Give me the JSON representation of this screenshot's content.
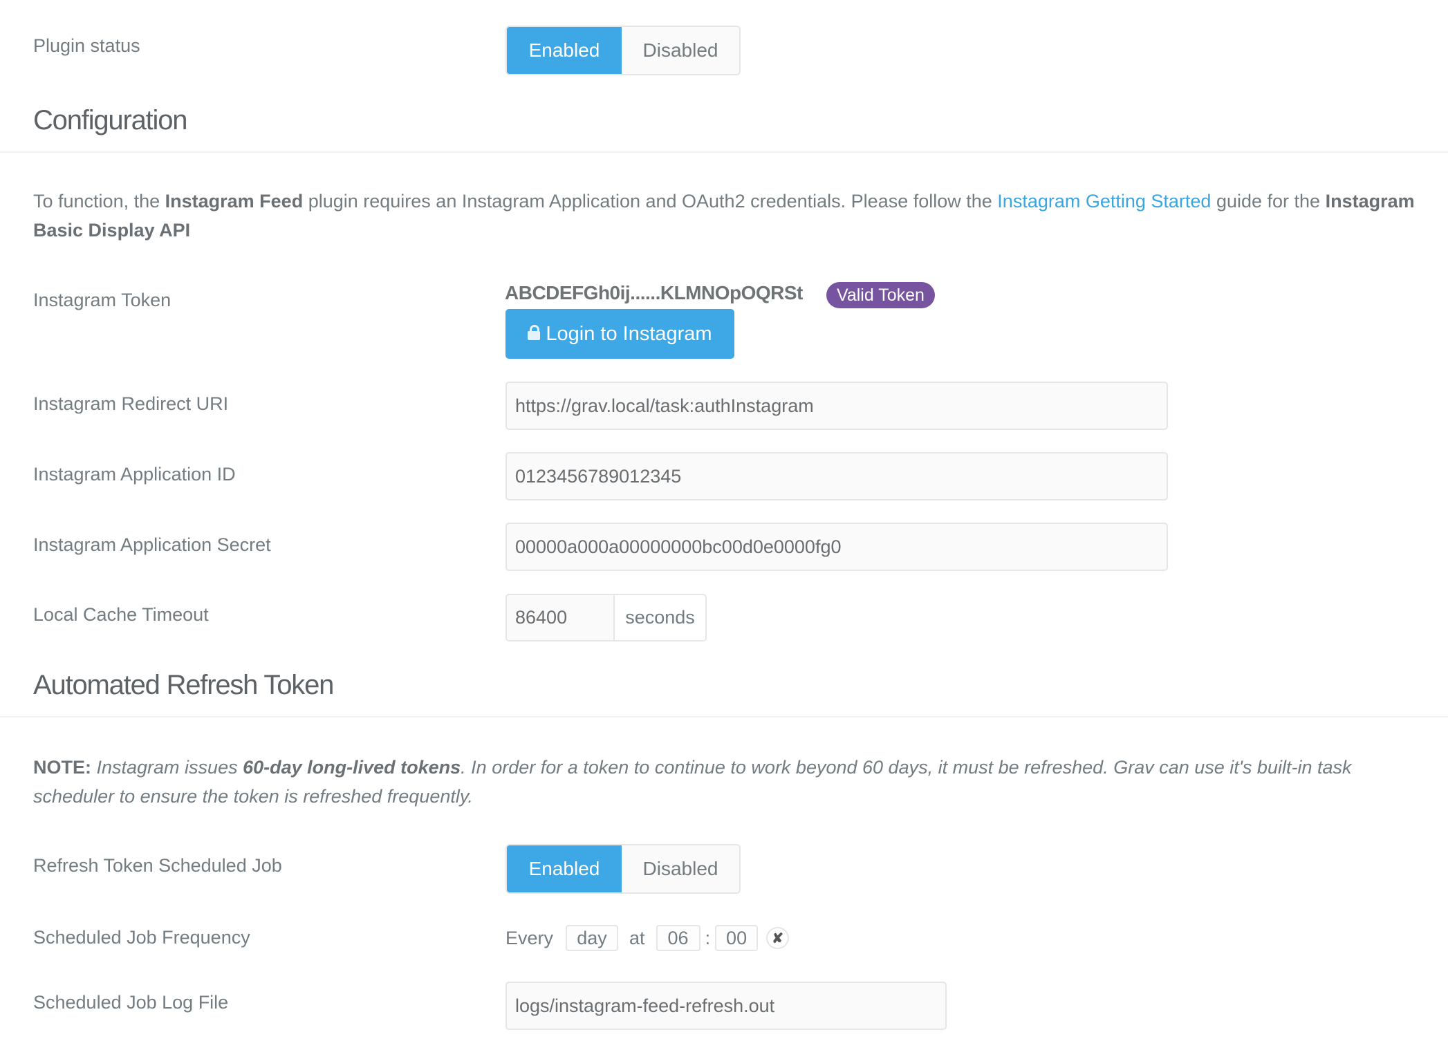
{
  "plugin_status": {
    "label": "Plugin status",
    "options": [
      "Enabled",
      "Disabled"
    ],
    "selected": "Enabled"
  },
  "configuration": {
    "heading": "Configuration",
    "intro": {
      "t1": "To function, the ",
      "b1": "Instagram Feed",
      "t2": " plugin requires an Instagram Application and OAuth2 credentials. Please follow the ",
      "link": "Instagram Getting Started",
      "t3": " guide for the ",
      "b2": "Instagram Basic Display API"
    },
    "token": {
      "label": "Instagram Token",
      "value": "ABCDEFGh0ij......KLMNOpOQRSt",
      "badge": "Valid Token",
      "login_button": "Login to Instagram"
    },
    "redirect_uri": {
      "label": "Instagram Redirect URI",
      "value": "https://grav.local/task:authInstagram"
    },
    "app_id": {
      "label": "Instagram Application ID",
      "value": "0123456789012345"
    },
    "app_secret": {
      "label": "Instagram Application Secret",
      "value": "00000a000a00000000bc00d0e0000fg0"
    },
    "cache_timeout": {
      "label": "Local Cache Timeout",
      "value": "86400",
      "unit": "seconds"
    }
  },
  "refresh": {
    "heading": "Automated Refresh Token",
    "note": {
      "b1": "NOTE:",
      "t1": " Instagram issues ",
      "b2": "60-day long-lived tokens",
      "t2": ". In order for a token to continue to work beyond 60 days, it must be refreshed. Grav can use it's built-in task scheduler to ensure the token is refreshed frequently."
    },
    "scheduled_job": {
      "label": "Refresh Token Scheduled Job",
      "options": [
        "Enabled",
        "Disabled"
      ],
      "selected": "Enabled"
    },
    "frequency": {
      "label": "Scheduled Job Frequency",
      "every": "Every",
      "period": "day",
      "at": "at",
      "hour": "06",
      "separator": ":",
      "minute": "00",
      "clear": "✘"
    },
    "log_file": {
      "label": "Scheduled Job Log File",
      "value": "logs/instagram-feed-refresh.out"
    }
  },
  "colors": {
    "primary": "#3ea7e5",
    "badge": "#7654a0",
    "link": "#3aa6e1",
    "text": "#737c81"
  }
}
